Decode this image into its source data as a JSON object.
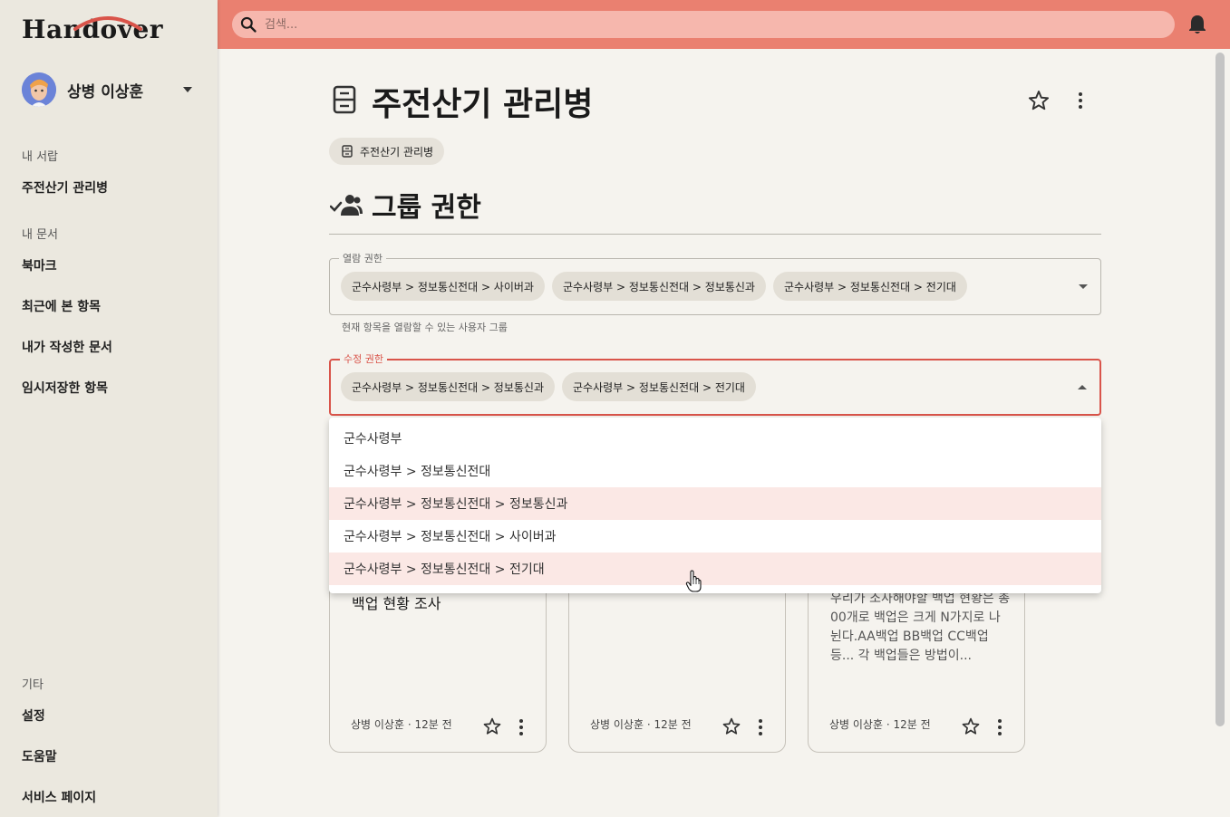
{
  "app": {
    "logo": "Handover",
    "brand_color": "#ea8070",
    "accent_color": "#d9544a"
  },
  "user": {
    "name": "상병 이상훈"
  },
  "sidebar": {
    "sections": [
      {
        "title": "내 서랍",
        "items": [
          "주전산기 관리병"
        ]
      },
      {
        "title": "내 문서",
        "items": [
          "북마크",
          "최근에 본 항목",
          "내가 작성한 문서",
          "임시저장한 항목"
        ]
      },
      {
        "title": "기타",
        "items": [
          "설정",
          "도움말",
          "서비스 페이지"
        ]
      }
    ]
  },
  "topbar": {
    "search_placeholder": "검색...",
    "icons": [
      "search-icon",
      "bell-icon"
    ]
  },
  "page": {
    "title": "주전산기 관리병",
    "breadcrumb": "주전산기 관리병",
    "section_title": "그룹 권한",
    "view_permission": {
      "label": "열람 권한",
      "chips": [
        "군수사령부 > 정보통신전대 > 사이버과",
        "군수사령부 > 정보통신전대 > 정보통신과",
        "군수사령부 > 정보통신전대 > 전기대"
      ],
      "helper": "현재 항목을 열람할 수 있는 사용자 그룹"
    },
    "edit_permission": {
      "label": "수정 권한",
      "chips": [
        "군수사령부 > 정보통신전대 > 정보통신과",
        "군수사령부 > 정보통신전대 > 전기대"
      ]
    },
    "dropdown_options": [
      {
        "label": "군수사령부",
        "selected": false
      },
      {
        "label": "군수사령부 > 정보통신전대",
        "selected": false
      },
      {
        "label": "군수사령부 > 정보통신전대 > 정보통신과",
        "selected": true
      },
      {
        "label": "군수사령부 > 정보통신전대 > 사이버과",
        "selected": false
      },
      {
        "label": "군수사령부 > 정보통신전대 > 전기대",
        "selected": true
      }
    ]
  },
  "cards": [
    {
      "title": "백업 현황 조사",
      "body": "",
      "meta": "상병 이상훈 · 12분 전"
    },
    {
      "title": "",
      "body": "",
      "meta": "상병 이상훈 · 12분 전"
    },
    {
      "title": "",
      "body": "우리가 조사해야할 백업 현황은 총 00개로 백업은 크게 N가지로 나뉜다.AA백업 BB백업 CC백업등... 각 백업들은 방법이...",
      "meta": "상병 이상훈 · 12분 전"
    }
  ]
}
